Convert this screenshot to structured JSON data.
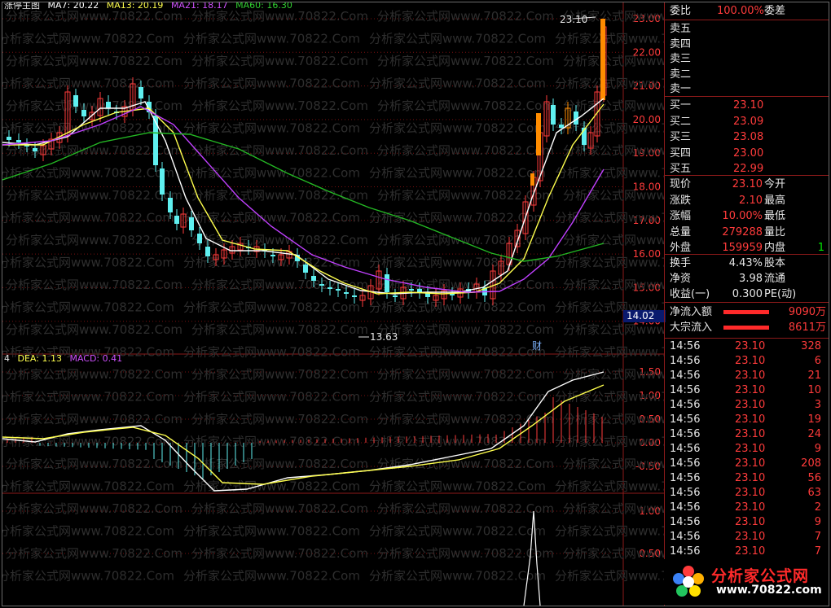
{
  "main_legend": {
    "name": "涨停主图",
    "ma7": "MA7: 20.22",
    "ma13": "MA13: 20.19",
    "ma21": "MA21: 18.17",
    "ma60": "MA60: 16.30"
  },
  "macd_legend": {
    "dif": "4",
    "dea": "DEA: 1.13",
    "macd": "MACD: 0.41"
  },
  "price_axis": [
    "23.00",
    "22.00",
    "21.00",
    "20.00",
    "19.00",
    "18.00",
    "17.00",
    "16.00",
    "15.00",
    "14.00"
  ],
  "macd_axis": [
    "1.50",
    "1.00",
    "0.50",
    "0.00",
    "-0.50"
  ],
  "bottom_axis": [
    "1.00",
    "0.50"
  ],
  "annotations": {
    "high": "23.10",
    "low": "13.63",
    "cai": "财",
    "current_price_tag": "14.02"
  },
  "watermark": "分析家公式网www.70822.Com",
  "colors": {
    "up": "#ff3b3b",
    "down": "#5ff0f0",
    "ma7": "#ffffff",
    "ma13": "#ffff4d",
    "ma21": "#c040ff",
    "ma60": "#24b824",
    "limit": "#ff8c00",
    "grid": "#7a1010"
  },
  "panel": {
    "weibi": {
      "label": "委比",
      "value": "100.00%",
      "label2": "委差"
    },
    "sells": [
      {
        "label": "卖五"
      },
      {
        "label": "卖四"
      },
      {
        "label": "卖三"
      },
      {
        "label": "卖二"
      },
      {
        "label": "卖一"
      }
    ],
    "buys": [
      {
        "label": "买一",
        "price": "23.10"
      },
      {
        "label": "买二",
        "price": "23.09"
      },
      {
        "label": "买三",
        "price": "23.08"
      },
      {
        "label": "买四",
        "price": "23.00"
      },
      {
        "label": "买五",
        "price": "22.99"
      }
    ],
    "quote": [
      {
        "label": "现价",
        "value": "23.10",
        "label2": "今开"
      },
      {
        "label": "涨跌",
        "value": "2.10",
        "label2": "最高"
      },
      {
        "label": "涨幅",
        "value": "10.00%",
        "label2": "最低"
      },
      {
        "label": "总量",
        "value": "279288",
        "label2": "量比"
      },
      {
        "label": "外盘",
        "value": "159959",
        "label2": "内盘",
        "value2": "1"
      }
    ],
    "stats": [
      {
        "label": "换手",
        "value": "4.43%",
        "label2": "股本"
      },
      {
        "label": "净资",
        "value": "3.98",
        "label2": "流通"
      },
      {
        "label": "收益(一)",
        "value": "0.300",
        "label2": "PE(动)"
      }
    ],
    "flows": [
      {
        "label": "净流入额",
        "value": "9090万"
      },
      {
        "label": "大宗流入",
        "value": "8611万"
      }
    ],
    "ticks": [
      {
        "time": "14:56",
        "price": "23.10",
        "vol": "328"
      },
      {
        "time": "14:56",
        "price": "23.10",
        "vol": "6"
      },
      {
        "time": "14:56",
        "price": "23.10",
        "vol": "21"
      },
      {
        "time": "14:56",
        "price": "23.10",
        "vol": "10"
      },
      {
        "time": "14:56",
        "price": "23.10",
        "vol": "3"
      },
      {
        "time": "14:56",
        "price": "23.10",
        "vol": "19"
      },
      {
        "time": "14:56",
        "price": "23.10",
        "vol": "24"
      },
      {
        "time": "14:56",
        "price": "23.10",
        "vol": "9"
      },
      {
        "time": "14:56",
        "price": "23.10",
        "vol": "208"
      },
      {
        "time": "14:56",
        "price": "23.10",
        "vol": "56"
      },
      {
        "time": "14:56",
        "price": "23.10",
        "vol": "63"
      },
      {
        "time": "14:56",
        "price": "23.10",
        "vol": "2"
      },
      {
        "time": "14:56",
        "price": "23.10",
        "vol": "9"
      },
      {
        "time": "14:56",
        "price": "23.10",
        "vol": "7"
      },
      {
        "time": "14:56",
        "price": "23.10",
        "vol": "7"
      }
    ],
    "logo": {
      "title": "分析家公式网",
      "url": "www.70822.com"
    }
  }
}
